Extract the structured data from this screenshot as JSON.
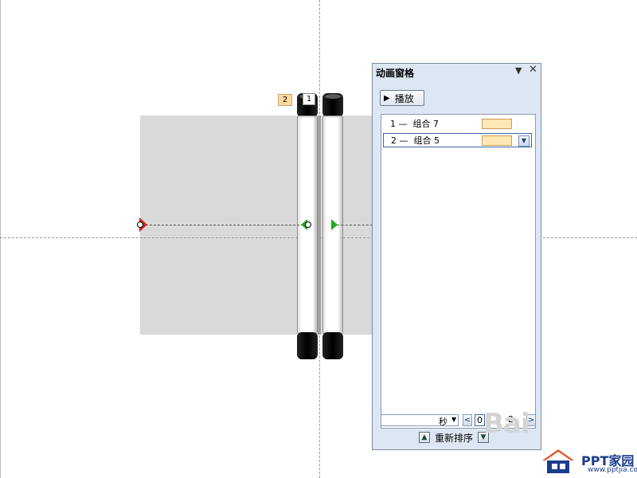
{
  "slide": {
    "tags": {
      "tag_2": "2",
      "tag_1": "1"
    }
  },
  "animation_pane": {
    "title": "动画窗格",
    "play_label": "播放",
    "items": [
      {
        "index": "1",
        "text": "1 —  组合 7"
      },
      {
        "index": "2",
        "text": "2 —  组合 5"
      }
    ],
    "seconds_label": "秒",
    "timeline_ticks": [
      "0",
      "2"
    ],
    "reorder_label": "重新排序"
  },
  "watermarks": {
    "baidu": "Bai",
    "ppt_brand": "PPT家园",
    "ppt_url": "www.pptjia.com"
  },
  "colors": {
    "pane_bg": "#dde7f3",
    "timing_bar": "#ffe8b5",
    "selection_border": "#3c65a4",
    "tag_orange": "#ffd9a0",
    "motion_start_green": "#22aa22",
    "motion_end_red": "#d42020"
  }
}
